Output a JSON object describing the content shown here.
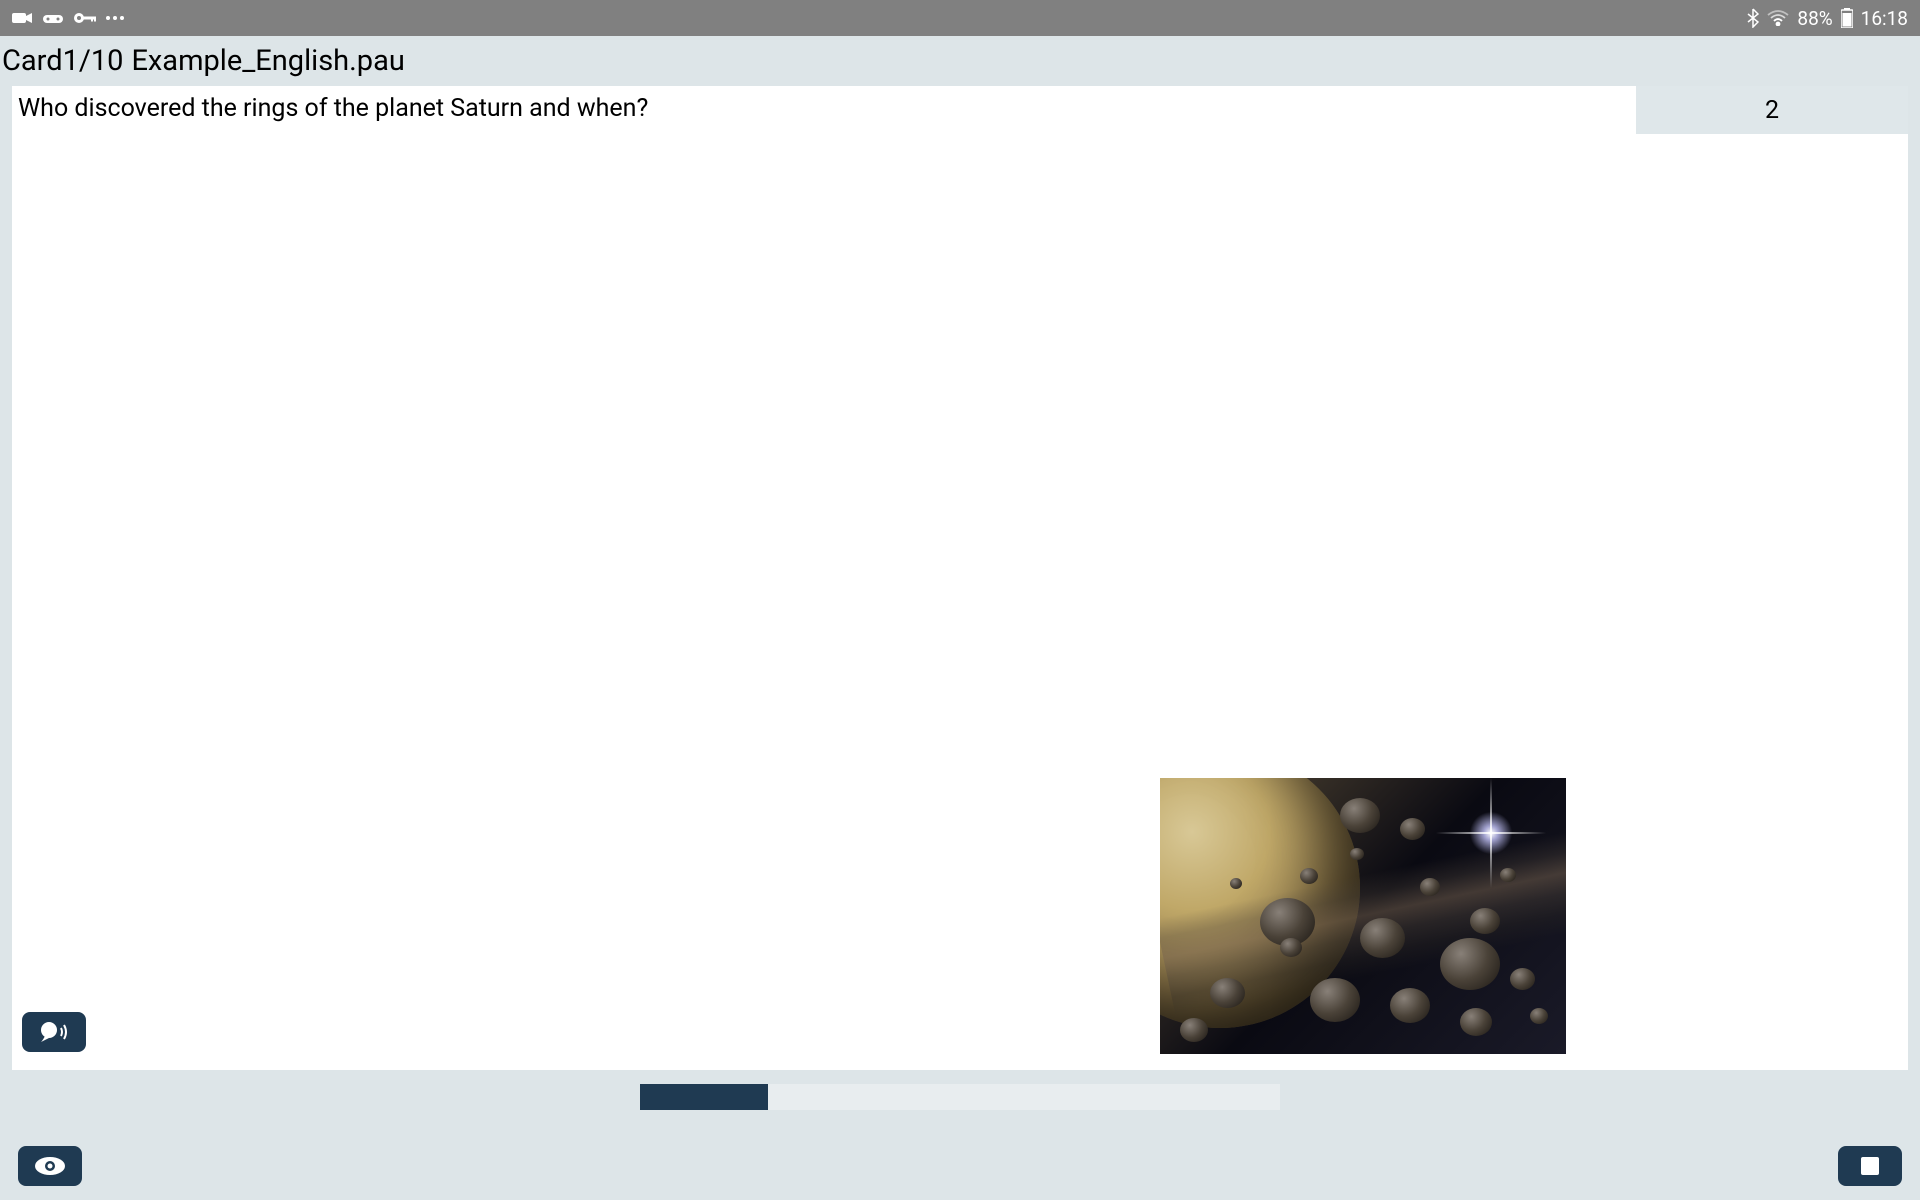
{
  "status_bar": {
    "battery_percent": "88%",
    "time": "16:18"
  },
  "title": {
    "card_indicator": "Card1/10",
    "filename": "Example_English.pau"
  },
  "card": {
    "question": "Who discovered the rings of the planet Saturn and when?",
    "side_number": "2"
  },
  "progress": {
    "percent": 20
  }
}
